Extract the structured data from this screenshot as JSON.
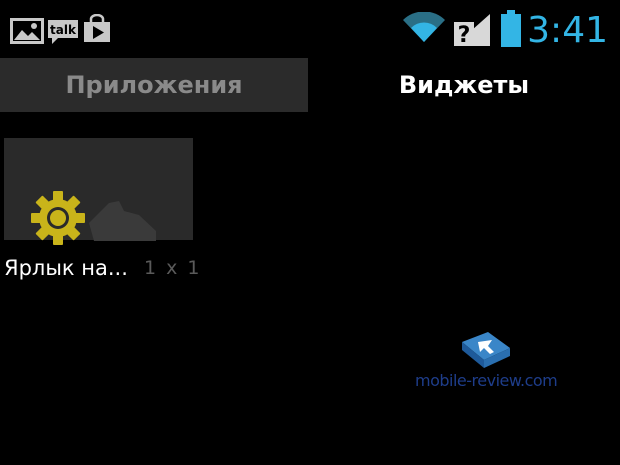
{
  "status_bar": {
    "time": "3:41",
    "notifications": [
      "gallery-icon",
      "talk-icon",
      "play-store-icon"
    ],
    "notification_talk_text": "talk",
    "indicators": [
      "wifi-icon",
      "no-sim-signal-icon",
      "battery-icon"
    ],
    "accent_color": "#33b5e5"
  },
  "tabs": [
    {
      "label": "Приложения",
      "selected": false
    },
    {
      "label": "Виджеты",
      "selected": true
    }
  ],
  "widgets": [
    {
      "name": "Ярлык на...",
      "size": "1 x 1",
      "icon": "settings-gear-icon",
      "icon_color": "#c9b41a"
    }
  ],
  "watermark": {
    "text": "mobile-review.com",
    "logo": "mobile-review-logo"
  }
}
